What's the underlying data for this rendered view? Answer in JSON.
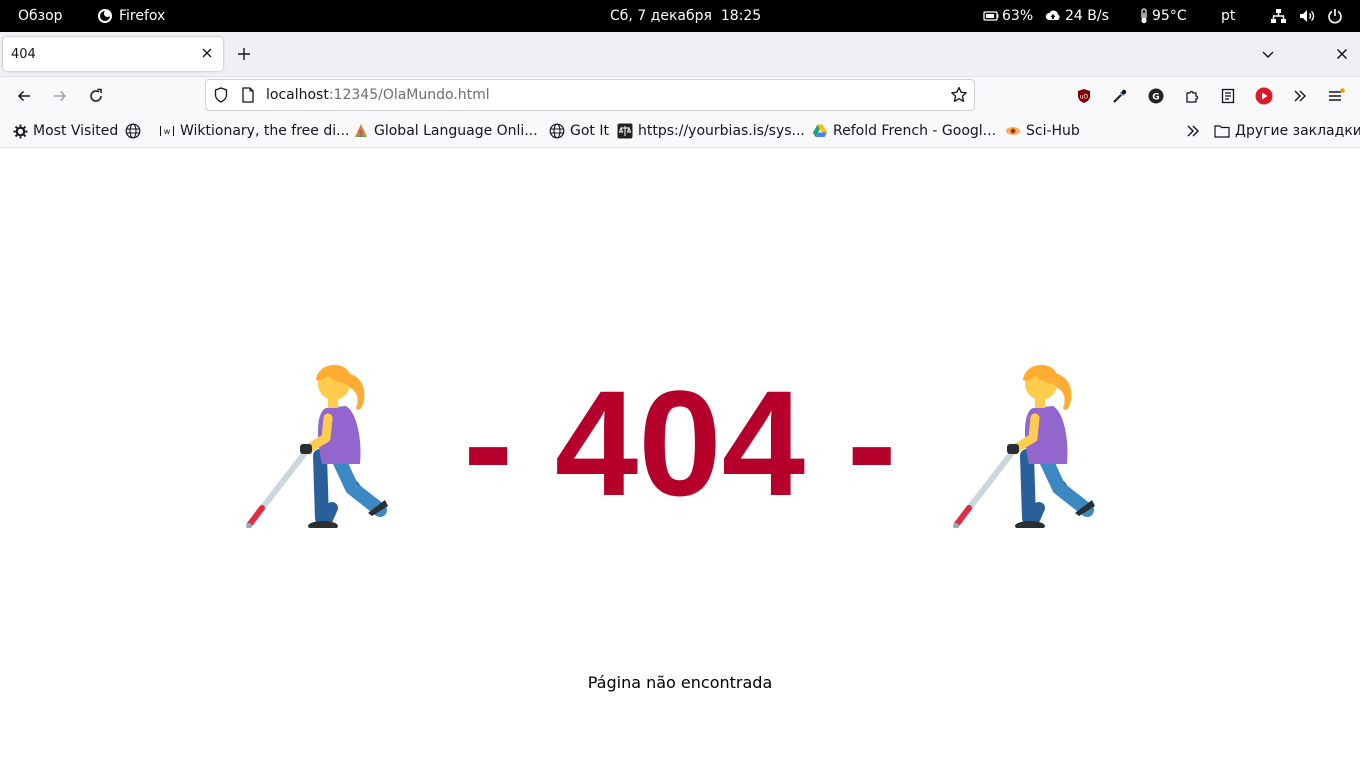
{
  "topbar": {
    "overview": "Обзор",
    "app_name": "Firefox",
    "clock": "Сб, 7 декабря  18:25",
    "battery": "63%",
    "network_speed": "24 B/s",
    "temperature": "95°C",
    "language": "pt"
  },
  "tabs": [
    {
      "title": "404"
    }
  ],
  "navbar": {
    "url_host": "localhost",
    "url_rest": ":12345/OlaMundo.html"
  },
  "bookmarks": {
    "items": [
      {
        "label": "Most Visited",
        "icon": "gear-icon"
      },
      {
        "label": "",
        "icon": "globe-icon"
      },
      {
        "label": "Wiktionary, the free di...",
        "icon": "wiktionary-icon"
      },
      {
        "label": "Global Language Onli...",
        "icon": "glossika-icon"
      },
      {
        "label": "Got It",
        "icon": "globe-icon"
      },
      {
        "label": "https://yourbias.is/sys...",
        "icon": "yourbias-icon"
      },
      {
        "label": "Refold French - Googl...",
        "icon": "drive-icon"
      },
      {
        "label": "Sci-Hub",
        "icon": "scihub-icon"
      }
    ],
    "other_bookmarks": "Другие закладки"
  },
  "page": {
    "heading": "- 404 -",
    "subtitle": "Página não encontrada",
    "emoji": "woman-with-white-cane"
  },
  "colors": {
    "heading": "#b5002b",
    "topbar_bg": "#000000"
  }
}
